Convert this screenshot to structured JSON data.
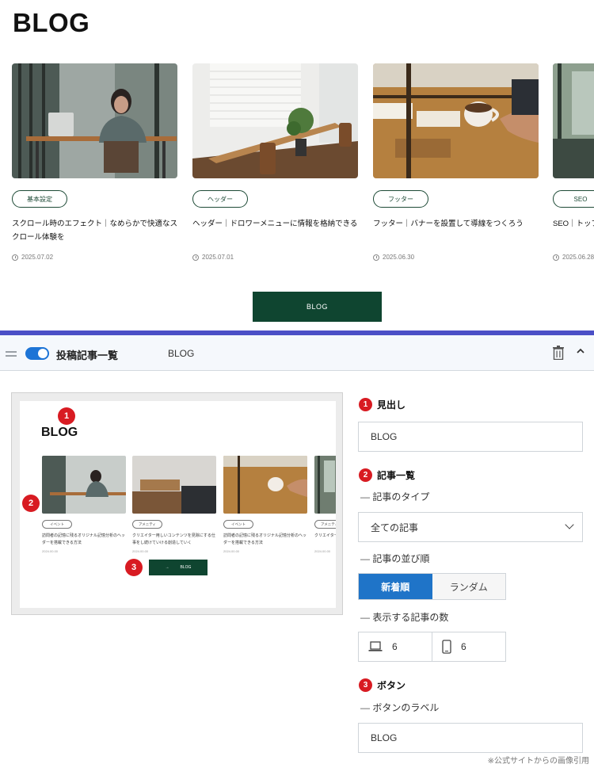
{
  "blog": {
    "title": "BLOG",
    "button_label": "BLOG",
    "cards": [
      {
        "tag": "基本設定",
        "title": "スクロール時のエフェクト｜なめらかで快適なスクロール体験を",
        "date": "2025.07.02"
      },
      {
        "tag": "ヘッダー",
        "title": "ヘッダー｜ドロワーメニューに情報を格納できる",
        "date": "2025.07.01"
      },
      {
        "tag": "フッター",
        "title": "フッター｜バナーを設置して導線をつくろう",
        "date": "2025.06.30"
      },
      {
        "tag": "SEO",
        "title": "SEO｜トップ設定可能",
        "date": "2025.06.28"
      }
    ]
  },
  "block": {
    "name": "投稿記事一覧",
    "subtitle": "BLOG",
    "toggle_on": true
  },
  "preview": {
    "title": "BLOG",
    "button_label": "BLOG",
    "button_arrow": "→",
    "cards": [
      {
        "tag": "イベント",
        "title": "訪問者の記憶に残るオリジナル記憶分析のヘッダーを搭載できる方法",
        "date": "2024.00.00"
      },
      {
        "tag": "アメニティ",
        "title": "クリエイター用しいコンテンツを見除にする仕事をし続けていける創造していく",
        "date": "2024.00.00"
      },
      {
        "tag": "イベント",
        "title": "訪問者の記憶に残るオリジナル記憶分析のヘッダーを搭載できる方法",
        "date": "2024.00.00"
      },
      {
        "tag": "アメニティ",
        "title": "クリエイター用しいコンテンツを仕事をし続",
        "date": "2024.00.00"
      }
    ],
    "badges": [
      "1",
      "2",
      "3"
    ]
  },
  "settings": {
    "heading": {
      "badge": "1",
      "label": "見出し",
      "value": "BLOG"
    },
    "list": {
      "badge": "2",
      "label": "記事一覧",
      "type_label": "記事のタイプ",
      "type_value": "全ての記事",
      "order_label": "記事の並び順",
      "order_options": [
        "新着順",
        "ランダム"
      ],
      "order_selected": "新着順",
      "count_label": "表示する記事の数",
      "count_desktop": "6",
      "count_mobile": "6"
    },
    "button": {
      "badge": "3",
      "label": "ボタン",
      "label_label": "ボタンのラベル",
      "value": "BLOG"
    }
  },
  "footnote": "※公式サイトからの画像引用",
  "colors": {
    "brand_green": "#0f4530",
    "accent_blue": "#1f74c8",
    "badge_red": "#d81b22",
    "divider": "#4b4fc6"
  }
}
